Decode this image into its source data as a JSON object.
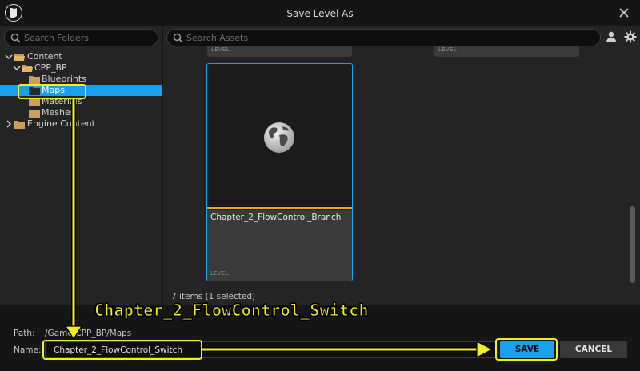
{
  "window": {
    "title": "Save Level As"
  },
  "left": {
    "search_placeholder": "Search Folders",
    "tree": [
      {
        "label": "Content",
        "expanded": true
      },
      {
        "label": "CPP_BP",
        "expanded": true
      },
      {
        "label": "Blueprints"
      },
      {
        "label": "Maps",
        "selected": true
      },
      {
        "label": "Materials"
      },
      {
        "label": "Meshes"
      },
      {
        "label": "Engine Content",
        "expanded": false
      }
    ]
  },
  "right": {
    "search_placeholder": "Search Assets",
    "top_tiles": [
      {
        "type": "LEVEL"
      },
      {
        "type": "LEVEL"
      }
    ],
    "selected_asset": {
      "name": "Chapter_2_FlowControl_Branch",
      "type": "LEVEL"
    },
    "item_count": "7 items (1 selected)"
  },
  "footer": {
    "path_label": "Path:",
    "path_value": "/Game/CPP_BP/Maps",
    "name_label": "Name:",
    "name_value": "Chapter_2_FlowControl_Switch",
    "save_label": "SAVE",
    "cancel_label": "CANCEL"
  },
  "annotation": {
    "text": "Chapter_2_FlowControl_Switch",
    "color": "#f2ef1d"
  },
  "colors": {
    "accent": "#1aa0ef",
    "thumbnail_underline": "#f0a21a",
    "background": "#242424"
  }
}
